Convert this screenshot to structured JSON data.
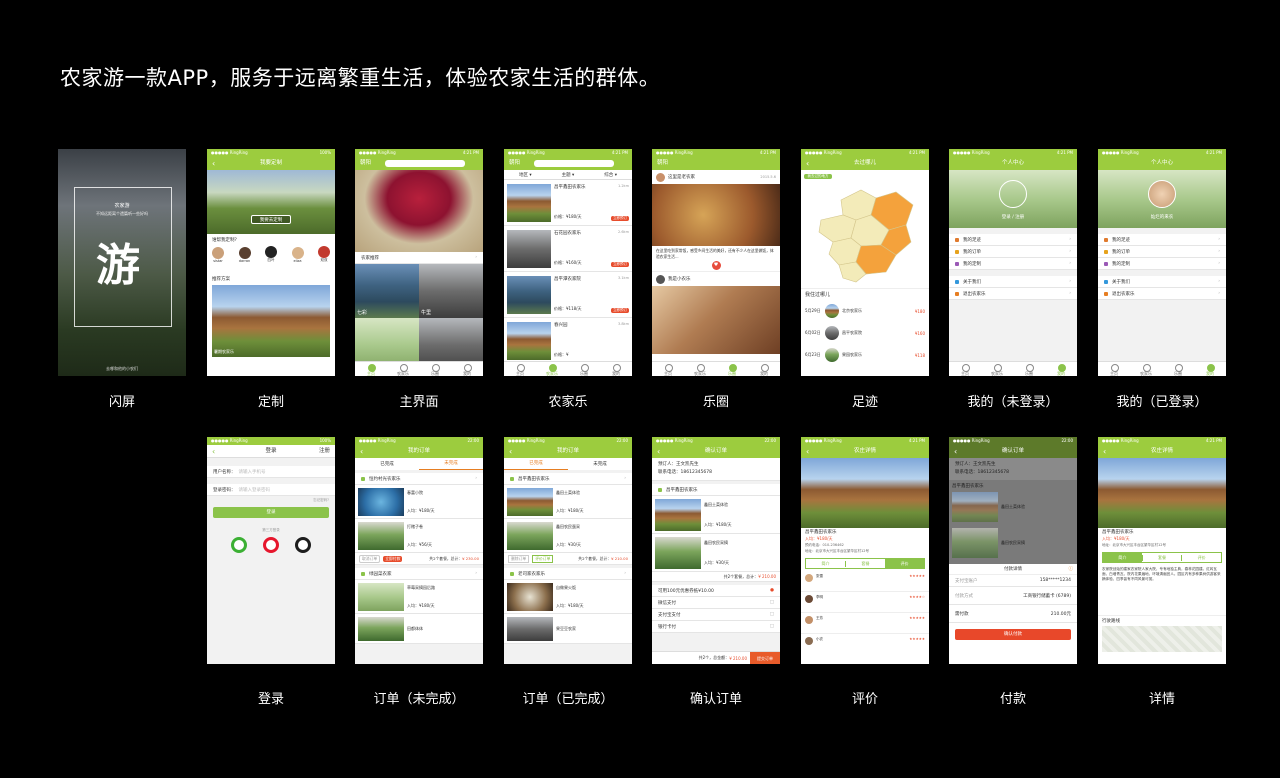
{
  "headline": "农家游一款APP，服务于远离繁重生活，体验农家生活的群体。",
  "status": {
    "carrier": "●●●●● RingRing",
    "time": "4:21 PM",
    "time2": "22:00",
    "battery": "100%"
  },
  "tabbar": {
    "home": "主页",
    "farm": "农家乐",
    "park": "乐圈",
    "mine": "我的"
  },
  "captions": {
    "splash": "闪屏",
    "custom": "定制",
    "main": "主界面",
    "farm": "农家乐",
    "park": "乐圈",
    "footprint": "足迹",
    "mine_out": "我的（未登录）",
    "mine_in": "我的（已登录）",
    "login": "登录",
    "order_pending": "订单（未完成）",
    "order_done": "订单（已完成）",
    "confirm": "确认订单",
    "review": "评价",
    "pay": "付款",
    "detail": "详情"
  },
  "splash": {
    "brand": "农家游",
    "tagline": "不知远距离个遗篇听一些好吗",
    "logo": "游",
    "foot": "去哪和他的小农们"
  },
  "custom": {
    "title": "我要定制",
    "banner": "我要去定制",
    "q": "谁帮我定制?",
    "users": [
      "sistar",
      "darran",
      "四叶",
      "eliza",
      "双双"
    ],
    "rec": "推荐方案",
    "cap": "暑期农家乐"
  },
  "main": {
    "city": "朝阳",
    "rec": "农家推荐",
    "tag1": "七彩",
    "tag2": "牛里"
  },
  "farm": {
    "filters": [
      "地区 ▾",
      "主题 ▾",
      "综合 ▾"
    ],
    "items": [
      {
        "name": "昌平鑫田农家乐",
        "dist": "1.2km",
        "price": "价格：¥180/天"
      },
      {
        "name": "石花园农家乐",
        "dist": "2.6km",
        "price": "价格：¥160/天"
      },
      {
        "name": "昌平潭农家院",
        "dist": "3.1km",
        "price": "价格：¥118/天"
      },
      {
        "name": "春兴园",
        "dist": "3.8km",
        "price": "价格：¥"
      }
    ],
    "book": "立即预订"
  },
  "park": {
    "user1": "这里是老农家",
    "text": "在这里吃到家常饭，感受乡间生活的美好，还有不少人在这里做饭，体验农家生活...",
    "user2": "我是小农乐",
    "time": "2015.5.6"
  },
  "footprint": {
    "title": "去过哪儿",
    "badge": "我去过的地方",
    "h": "我住过哪儿",
    "items": [
      {
        "date": "5月29日",
        "place": "北京农家乐",
        "price": "¥180"
      },
      {
        "date": "6月02日",
        "place": "昌平农家院",
        "price": "¥160"
      },
      {
        "date": "6月23日",
        "place": "果园农家乐",
        "price": "¥118"
      }
    ]
  },
  "mine_out": {
    "title": "个人中心",
    "login": "登录 / 注册",
    "menu": [
      "我的足迹",
      "我的订单",
      "我的定制",
      "关于我们",
      "退出农家乐"
    ]
  },
  "mine_in": {
    "title": "个人中心",
    "name": "灿烂的来农",
    "menu": [
      "我的足迹",
      "我的订单",
      "我的定制",
      "关于我们",
      "退出农家乐"
    ]
  },
  "login": {
    "title": "登录",
    "reg": "注册",
    "user_label": "用户名称：",
    "user_ph": "请输入手机号",
    "pwd_label": "登录密码：",
    "pwd_ph": "请输入登录密码",
    "forgot": "忘记密码?",
    "btn": "登录",
    "third": "第三方登录"
  },
  "order_pending": {
    "title": "我的订单",
    "tab1": "已完成",
    "tab2": "未完成",
    "shop1": "恒约村光农家乐",
    "dish1": "春富小院",
    "price1": "入均：¥180/天",
    "dish2": "打赌子卷",
    "price2": "入均：¥56/天",
    "total": "共2个套餐，总计：",
    "sum": "¥ 230.00",
    "btn1": "取消订单",
    "btn2": "立即付款",
    "shop2": "绿园菜农家",
    "dish3": "草莓采摘园后路",
    "price3": "入均：¥180/天",
    "dish4": "田都体体"
  },
  "order_done": {
    "title": "我的订单",
    "tab1": "已完成",
    "tab2": "未完成",
    "shop1": "昌平鑫田农家乐",
    "dish1": "鑫田土菜体验",
    "price1": "入均：¥180/天",
    "dish2": "鑫田农民蛋采",
    "price2": "入均：¥30/天",
    "total": "共2个套餐，总计：",
    "sum": "¥ 210.00",
    "btn1": "删除订单",
    "btn2": "评价订单",
    "shop2": "老司家农家乐",
    "dish3": "自做果火饭",
    "price3": "入均：¥180/天",
    "dish4": "果豆豆农家"
  },
  "confirm": {
    "title": "确认订单",
    "contact": "预订人：王文凯先生",
    "phone": "联系电话：18612345678",
    "shop": "昌平鑫田农家乐",
    "dish1": "鑫田土菜体验",
    "price1": "入均：¥180/天",
    "dish2": "鑫田农民采摘",
    "price2": "入均：¥30/天",
    "total": "共2个套餐，总计：",
    "sum": "¥ 210.00",
    "coupon": "可用100元优惠券抵¥10.00",
    "pay1": "微信支付",
    "pay2": "支付宝支付",
    "pay3": "银行卡付",
    "bottom_total": "共2个，总金额：",
    "bottom_sum": "¥ 210.00",
    "submit": "提交订单"
  },
  "review": {
    "title": "农庄详情",
    "name": "昌平鑫田农家乐",
    "price": "入均：¥180/天",
    "phone": "预约电话：010-236462",
    "addr": "地址：北京市大兴区丰台区繁华区村12号",
    "tabs": [
      "简介",
      "套餐",
      "评价"
    ],
    "users": [
      "张雪",
      "李明",
      "王芳",
      "小农"
    ]
  },
  "pay": {
    "title": "确认订单",
    "contact": "预订人：王文凯先生",
    "phone": "联系电话：18612345678",
    "shop": "昌平鑫田农家乐",
    "dish1": "鑫田土菜体验",
    "dish2": "鑫田农民采摘",
    "sheet": "付款详情",
    "acct": "支付宝账户",
    "acct_val": "158*****1234",
    "method": "付款方式",
    "method_val": "工商银行储蓄卡 (6789)",
    "amount": "需付款",
    "amount_val": "210.00元",
    "btn": "确认付款"
  },
  "detail": {
    "title": "农庄详情",
    "name": "昌平鑫田农家乐",
    "price": "入均：¥180/天",
    "addr": "地址：北京市大兴区丰台区繁华区村12号",
    "tabs": [
      "简介",
      "套餐",
      "评价"
    ],
    "desc": "农家院创始的建家农家院人家大院，专有地独主典，春林花园建。红砖瓦面，白墙青瓦，院内花果遍地，环境清幽宜人。园区内有多种果树供游客采摘体验，四季皆有不同风景可赏。",
    "route": "行驶路线"
  }
}
